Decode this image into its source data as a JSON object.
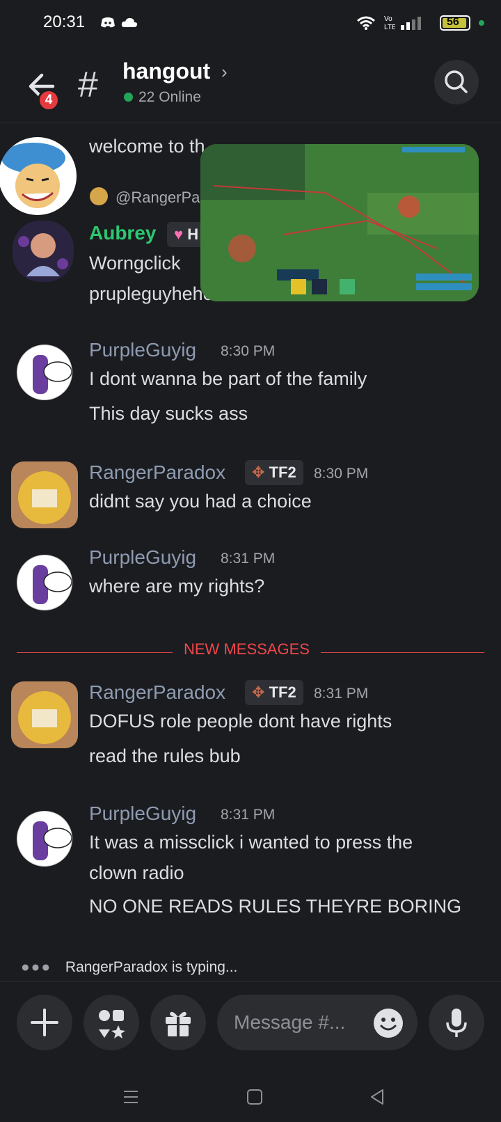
{
  "status_bar": {
    "time": "20:31",
    "battery": "56"
  },
  "header": {
    "channel_name": "hangout",
    "online_count": "22 Online",
    "unread_badge": "4",
    "hash": "#"
  },
  "messages_top": {
    "cut_text_1": "welcome to th",
    "reply_mention": "@RangerPa",
    "aubrey": {
      "name": "Aubrey",
      "role_initial": "H",
      "line1": "Worngclick",
      "line2": "prupleguyhehehe"
    }
  },
  "messages": [
    {
      "user": "PurpleGuyig",
      "time": "8:30 PM",
      "lines": [
        "I dont wanna be part of the family",
        "This day sucks ass"
      ]
    },
    {
      "user": "RangerParadox",
      "role": "TF2",
      "time": "8:30 PM",
      "lines": [
        "didnt say you had a choice"
      ]
    },
    {
      "user": "PurpleGuyig",
      "time": "8:31 PM",
      "lines": [
        "where are my rights?"
      ]
    },
    {
      "user": "RangerParadox",
      "role": "TF2",
      "time": "8:31 PM",
      "lines": [
        "DOFUS role people dont have rights",
        "read the rules bub"
      ]
    },
    {
      "user": "PurpleGuyig",
      "time": "8:31 PM",
      "lines": [
        "It was a missclick i wanted to press the",
        "clown radio",
        "NO ONE READS RULES THEYRE BORING"
      ]
    }
  ],
  "divider": {
    "label": "NEW MESSAGES"
  },
  "typing": {
    "text": "RangerParadox is typing..."
  },
  "composer": {
    "placeholder": "Message #..."
  },
  "colors": {
    "accent_green": "#23a55a",
    "new_messages_red": "#f0474a",
    "username_gray": "#8e9bb0",
    "aubrey_green": "#2dc770"
  },
  "icons": [
    "back-arrow-icon",
    "search-icon",
    "plus-icon",
    "apps-icon",
    "gift-icon",
    "emoji-icon",
    "mic-icon",
    "wifi-icon",
    "discord-icon",
    "cloud-icon"
  ]
}
